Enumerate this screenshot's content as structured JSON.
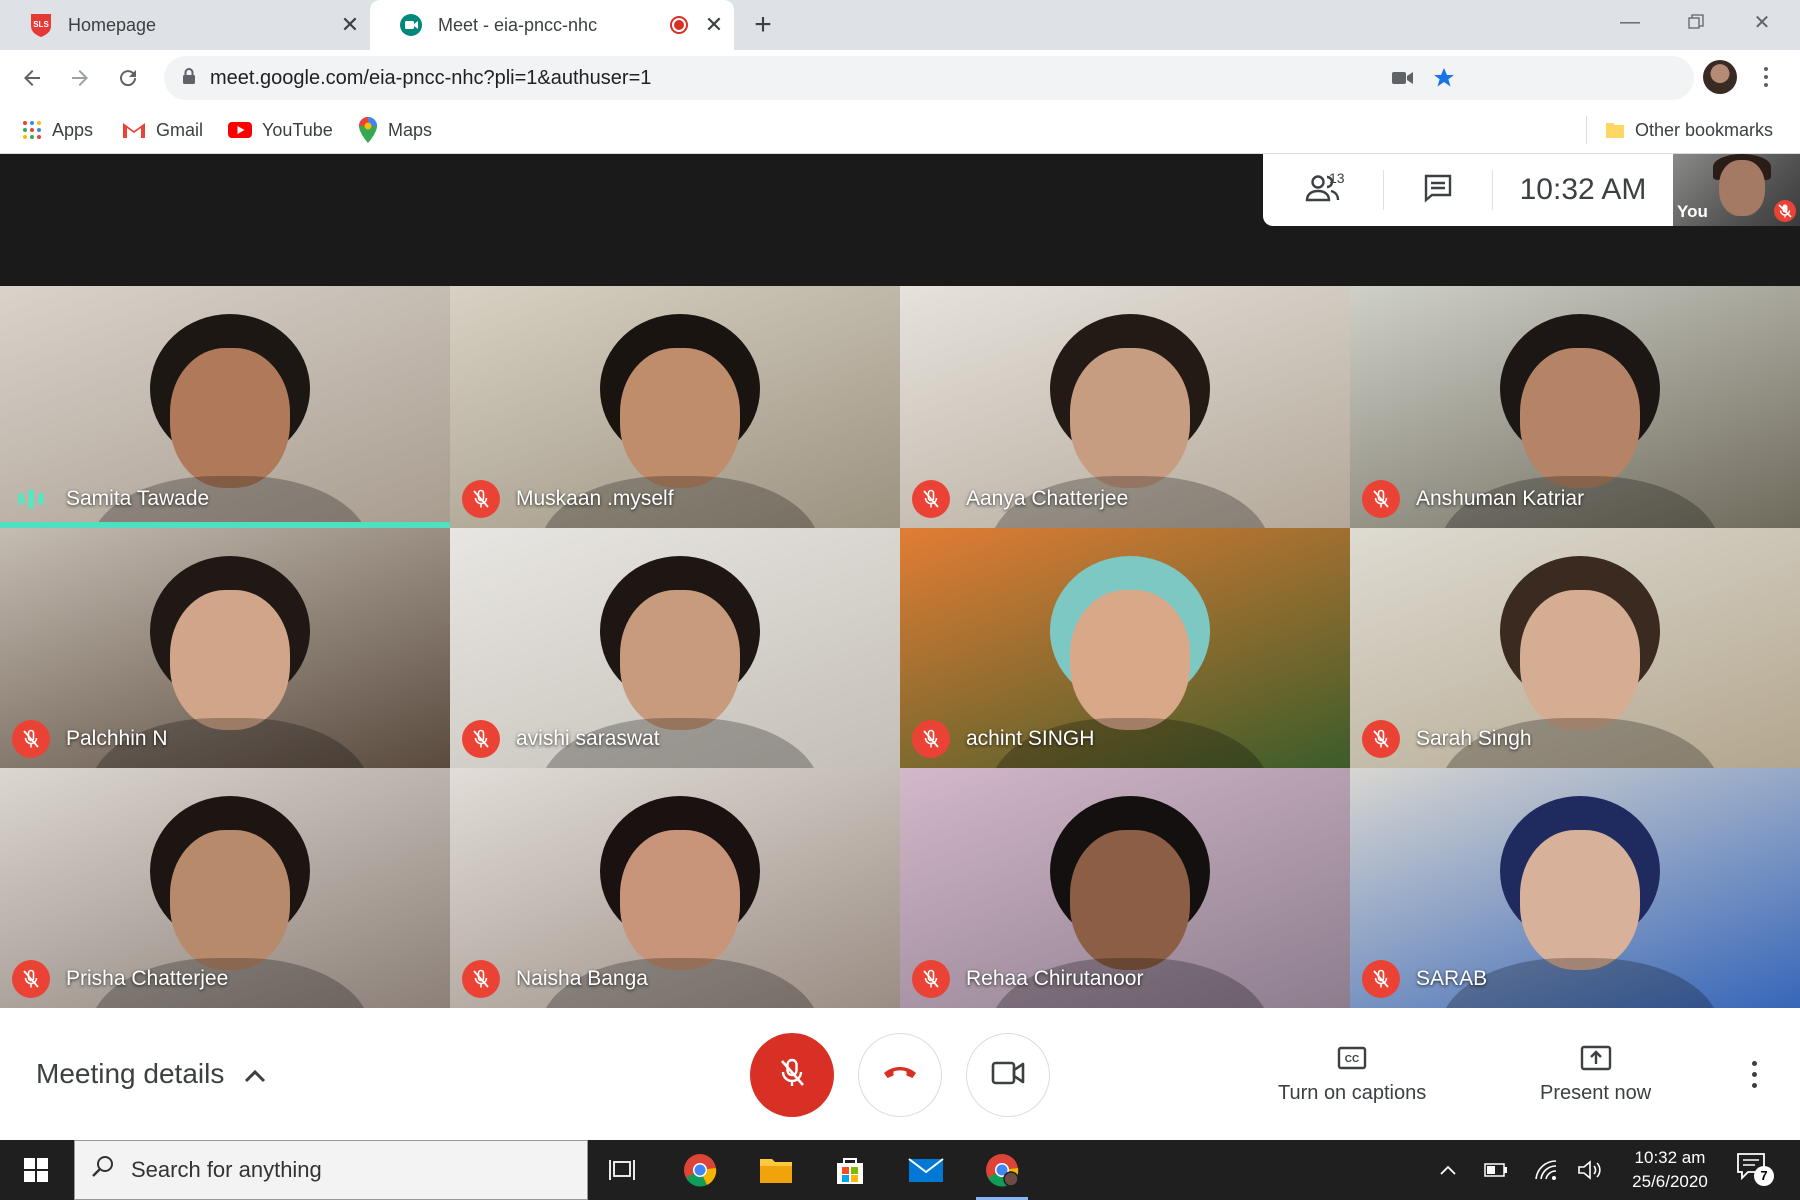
{
  "browser": {
    "tabs": [
      {
        "title": "Homepage",
        "favicon": "sls-logo-icon",
        "active": false
      },
      {
        "title": "Meet - eia-pncc-nhc",
        "favicon": "google-meet-icon",
        "active": true,
        "recording": true
      }
    ],
    "url": "meet.google.com/eia-pncc-nhc?pli=1&authuser=1",
    "bookmarks": [
      {
        "label": "Apps",
        "icon": "apps-grid-icon"
      },
      {
        "label": "Gmail",
        "icon": "gmail-icon"
      },
      {
        "label": "YouTube",
        "icon": "youtube-icon"
      },
      {
        "label": "Maps",
        "icon": "maps-pin-icon"
      }
    ],
    "other_bookmarks": "Other bookmarks"
  },
  "meet": {
    "participant_count": "13",
    "time": "10:32  AM",
    "self_label": "You",
    "participants": [
      {
        "name": "Samita Tawade",
        "speaking": true,
        "bg": [
          "#d9d3cb",
          "#a89c8f"
        ],
        "skin": "#b07a5a",
        "hair": "#1d1714"
      },
      {
        "name": "Muskaan .myself",
        "speaking": false,
        "bg": [
          "#d8d2c4",
          "#9c9280"
        ],
        "skin": "#c08d6c",
        "hair": "#1a1411"
      },
      {
        "name": "Aanya Chatterjee",
        "speaking": false,
        "bg": [
          "#e6e2dc",
          "#b3a899"
        ],
        "skin": "#c79d82",
        "hair": "#231a16"
      },
      {
        "name": "Anshuman Katriar",
        "speaking": false,
        "bg": [
          "#cfd0c8",
          "#6f6a5c"
        ],
        "skin": "#b58466",
        "hair": "#1c1714"
      },
      {
        "name": "Palchhin N",
        "speaking": false,
        "bg": [
          "#c5bdb2",
          "#5a4a3e"
        ],
        "skin": "#d1a58a",
        "hair": "#201814"
      },
      {
        "name": "avishi saraswat",
        "speaking": false,
        "bg": [
          "#e8e6e2",
          "#c4bfb7"
        ],
        "skin": "#c89b7d",
        "hair": "#1e1613"
      },
      {
        "name": "achint SINGH",
        "speaking": false,
        "bg": [
          "#e27d35",
          "#3c5c2a"
        ],
        "skin": "#d9a889",
        "hair": "#7ec8c4"
      },
      {
        "name": "Sarah Singh",
        "speaking": false,
        "bg": [
          "#dedbd2",
          "#b3a68e"
        ],
        "skin": "#d5ad92",
        "hair": "#3a2a20"
      },
      {
        "name": "Prisha Chatterjee",
        "speaking": false,
        "bg": [
          "#dcd7d0",
          "#8c8079"
        ],
        "skin": "#b88a6c",
        "hair": "#1c1512"
      },
      {
        "name": "Naisha Banga",
        "speaking": false,
        "bg": [
          "#e2ddd8",
          "#9a8d84"
        ],
        "skin": "#c8957a",
        "hair": "#1a1210"
      },
      {
        "name": "Rehaa Chirutanoor",
        "speaking": false,
        "bg": [
          "#d3b8c9",
          "#8c7d8d"
        ],
        "skin": "#8c5e46",
        "hair": "#151010"
      },
      {
        "name": "SARAB",
        "speaking": false,
        "bg": [
          "#d8d6d1",
          "#3766b8"
        ],
        "skin": "#d8b19a",
        "hair": "#1f2a5e"
      }
    ]
  },
  "bottom": {
    "meeting_details": "Meeting details",
    "captions": "Turn on captions",
    "present": "Present now"
  },
  "taskbar": {
    "search_placeholder": "Search for anything",
    "time": "10:32 am",
    "date": "25/6/2020",
    "notifications": "7"
  },
  "colors": {
    "accent_red": "#d93025",
    "speaking_teal": "#4ee0c0",
    "chrome_blue": "#1a73e8"
  }
}
